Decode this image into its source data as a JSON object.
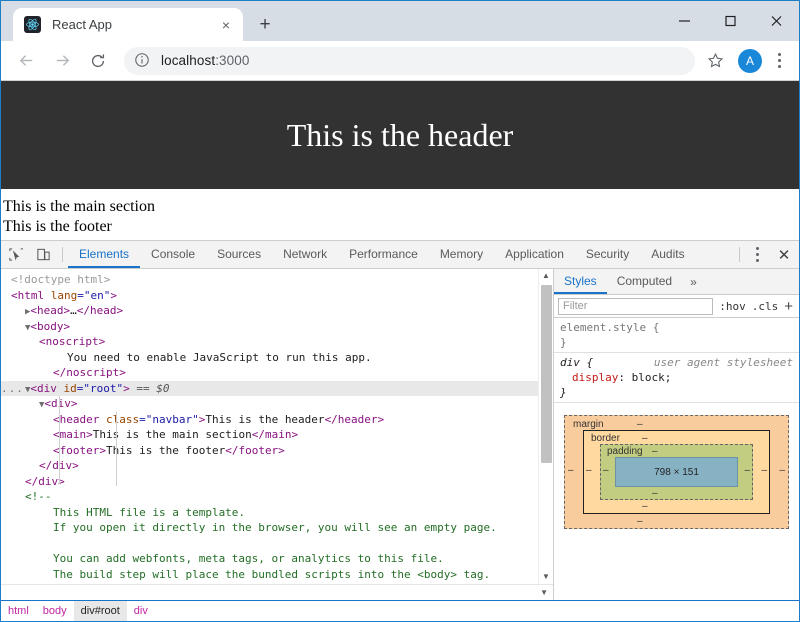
{
  "browser": {
    "tab": {
      "title": "React App",
      "favicon": "react-logo-icon",
      "close_label": "×"
    },
    "new_tab_label": "+",
    "window_controls": {
      "minimize": "–",
      "maximize": "□",
      "close": "✕"
    },
    "nav": {
      "back": "←",
      "forward": "→",
      "reload": "⟳"
    },
    "omnibox": {
      "info_icon": "info-circle-icon",
      "url_host": "localhost",
      "url_port": ":3000"
    },
    "star_icon": "star-icon",
    "avatar_letter": "A",
    "menu_icon": "kebab-menu-icon"
  },
  "page": {
    "header_text": "This is the header",
    "main_text": "This is the main section",
    "footer_text": "This is the footer",
    "header_bg": "#323232"
  },
  "devtools": {
    "inspect_icon": "inspect-element-icon",
    "device_icon": "device-toolbar-icon",
    "tabs": [
      {
        "label": "Elements",
        "active": true
      },
      {
        "label": "Console",
        "active": false
      },
      {
        "label": "Sources",
        "active": false
      },
      {
        "label": "Network",
        "active": false
      },
      {
        "label": "Performance",
        "active": false
      },
      {
        "label": "Memory",
        "active": false
      },
      {
        "label": "Application",
        "active": false
      },
      {
        "label": "Security",
        "active": false
      },
      {
        "label": "Audits",
        "active": false
      }
    ],
    "more_icon": "kebab-menu-icon",
    "close_label": "✕",
    "dom": {
      "lines": [
        {
          "id": "l0",
          "indent": 0,
          "html": "<span class=\"doct\">&lt;!doctype html&gt;</span>"
        },
        {
          "id": "l1",
          "indent": 0,
          "html": "<span class=\"tag\">&lt;html</span> <span class=\"attr\">lang</span><span class=\"val\">=\"en\"</span><span class=\"tag\">&gt;</span>"
        },
        {
          "id": "l2",
          "indent": 1,
          "html": "<span class=\"tri\">▶</span><span class=\"tag\">&lt;head&gt;</span><span class=\"txt\">…</span><span class=\"tag\">&lt;/head&gt;</span>"
        },
        {
          "id": "l3",
          "indent": 1,
          "html": "<span class=\"tri\">▼</span><span class=\"tag\">&lt;body&gt;</span>"
        },
        {
          "id": "l4",
          "indent": 2,
          "html": "<span class=\"tag\">&lt;noscript&gt;</span>"
        },
        {
          "id": "l5",
          "indent": 4,
          "html": "<span class=\"txt\">You need to enable JavaScript to run this app.</span>"
        },
        {
          "id": "l6",
          "indent": 3,
          "html": "<span class=\"tag\">&lt;/noscript&gt;</span>"
        },
        {
          "id": "l7",
          "indent": 1,
          "selected": true,
          "html": "<span class=\"tri\">▼</span><span class=\"tag\">&lt;div</span> <span class=\"attr\">id</span><span class=\"val\">=\"root\"</span><span class=\"tag\">&gt;</span> <span class=\"dollar\">== $0</span>"
        },
        {
          "id": "l8",
          "indent": 2,
          "html": "<span class=\"tri\">▼</span><span class=\"tag\">&lt;div&gt;</span>"
        },
        {
          "id": "l9",
          "indent": 3,
          "html": "<span class=\"tag\">&lt;header</span> <span class=\"attr\">class</span><span class=\"val\">=\"navbar\"</span><span class=\"tag\">&gt;</span><span class=\"txt\">This is the header</span><span class=\"tag\">&lt;/header&gt;</span>"
        },
        {
          "id": "l10",
          "indent": 3,
          "html": "<span class=\"tag\">&lt;main&gt;</span><span class=\"txt\">This is the main section</span><span class=\"tag\">&lt;/main&gt;</span>"
        },
        {
          "id": "l11",
          "indent": 3,
          "html": "<span class=\"tag\">&lt;footer&gt;</span><span class=\"txt\">This is the footer</span><span class=\"tag\">&lt;/footer&gt;</span>"
        },
        {
          "id": "l12",
          "indent": 2,
          "html": "<span class=\"tag\">&lt;/div&gt;</span>"
        },
        {
          "id": "l13",
          "indent": 1,
          "html": "<span class=\"tag\">&lt;/div&gt;</span>"
        },
        {
          "id": "l14",
          "indent": 1,
          "html": "<span class=\"cmt\">&lt;!--</span>"
        },
        {
          "id": "l15",
          "indent": 3,
          "html": "<span class=\"cmt\">This HTML file is a template.</span>"
        },
        {
          "id": "l16",
          "indent": 3,
          "html": "<span class=\"cmt\">If you open it directly in the browser, you will see an empty page.</span>"
        },
        {
          "id": "l17",
          "indent": 3,
          "html": "<span class=\"cmt\">&nbsp;</span>"
        },
        {
          "id": "l18",
          "indent": 3,
          "html": "<span class=\"cmt\">You can add webfonts, meta tags, or analytics to this file.</span>"
        },
        {
          "id": "l19",
          "indent": 3,
          "html": "<span class=\"cmt\">The build step will place the bundled scripts into the &lt;body&gt; tag.</span>"
        }
      ]
    },
    "styles": {
      "tabs": [
        {
          "label": "Styles",
          "active": true
        },
        {
          "label": "Computed",
          "active": false
        }
      ],
      "more_label": "»",
      "filter_placeholder": "Filter",
      "hov_label": ":hov",
      "cls_label": ".cls",
      "plus_label": "+",
      "rules": [
        {
          "selector": "element.style {",
          "close": "}",
          "origin": "",
          "declarations": []
        },
        {
          "selector": "div {",
          "close": "}",
          "origin": "user agent stylesheet",
          "declarations": [
            {
              "prop": "display",
              "value": "block;"
            }
          ]
        }
      ],
      "box_model": {
        "margin_label": "margin",
        "border_label": "border",
        "padding_label": "padding",
        "content_size": "798 × 151",
        "dash": "–",
        "colors": {
          "margin": "#f9cc9d",
          "border": "#ffd9a0",
          "padding": "#c3cd82",
          "content": "#87b2c4"
        }
      }
    },
    "breadcrumb": [
      {
        "label": "html",
        "selected": false
      },
      {
        "label": "body",
        "selected": false
      },
      {
        "label": "div#root",
        "selected": true
      },
      {
        "label": "div",
        "selected": false
      }
    ]
  }
}
